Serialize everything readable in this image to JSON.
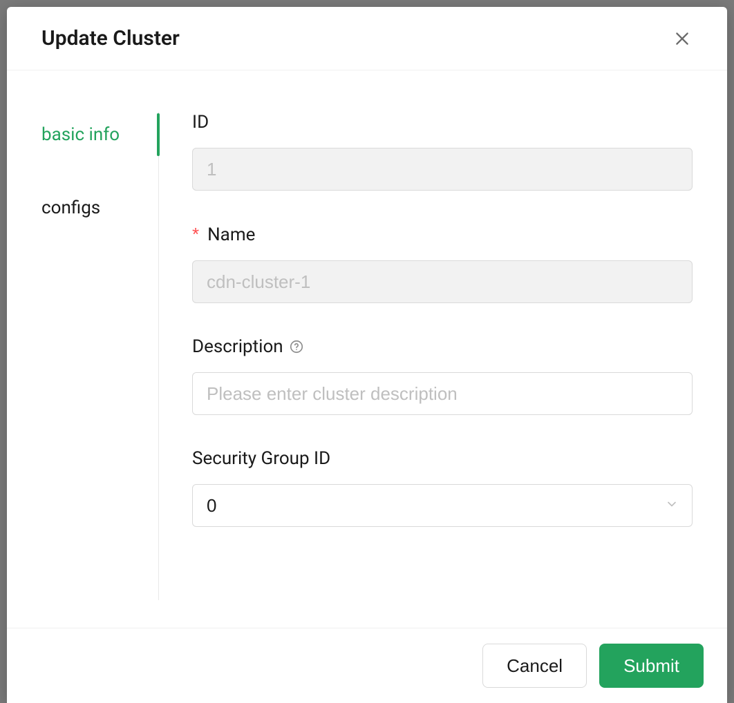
{
  "modal": {
    "title": "Update Cluster"
  },
  "tabs": [
    {
      "key": "basic-info",
      "label": "basic info",
      "active": true
    },
    {
      "key": "configs",
      "label": "configs",
      "active": false
    }
  ],
  "form": {
    "id": {
      "label": "ID",
      "value": "1"
    },
    "name": {
      "label": "Name",
      "required": true,
      "value": "cdn-cluster-1"
    },
    "description": {
      "label": "Description",
      "placeholder": "Please enter cluster description",
      "value": ""
    },
    "security_group_id": {
      "label": "Security Group ID",
      "value": "0"
    }
  },
  "footer": {
    "cancel_label": "Cancel",
    "submit_label": "Submit"
  }
}
